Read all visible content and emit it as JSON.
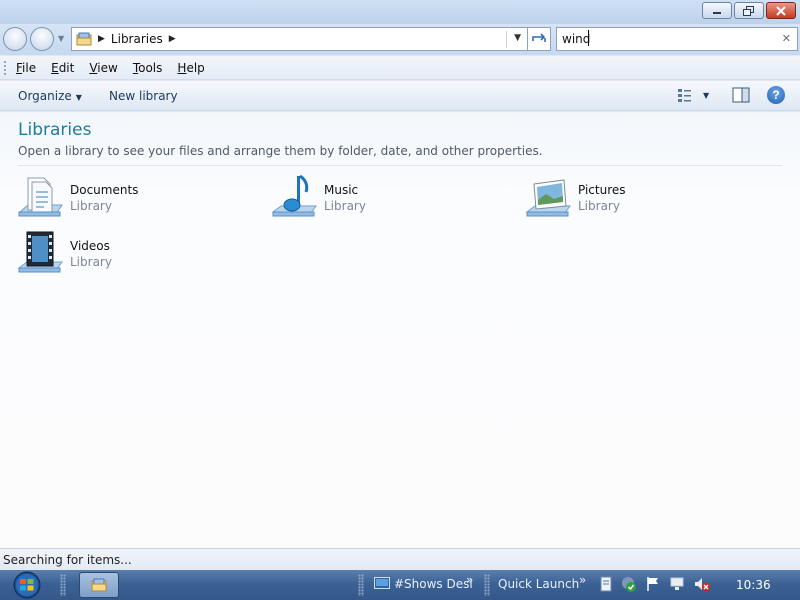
{
  "window": {
    "controls": [
      "minimize-icon",
      "restore-icon",
      "close-icon"
    ]
  },
  "address_bar": {
    "crumbs": [
      "Libraries"
    ],
    "search_value": "wind"
  },
  "menu": {
    "items": [
      {
        "label": "File",
        "accel": "F",
        "rest": "ile"
      },
      {
        "label": "Edit",
        "accel": "E",
        "rest": "dit"
      },
      {
        "label": "View",
        "accel": "V",
        "rest": "iew"
      },
      {
        "label": "Tools",
        "accel": "T",
        "rest": "ools"
      },
      {
        "label": "Help",
        "accel": "H",
        "rest": "elp"
      }
    ]
  },
  "toolbar": {
    "organize_label": "Organize",
    "new_library_label": "New library"
  },
  "content": {
    "title": "Libraries",
    "description": "Open a library to see your files and arrange them by folder, date, and other properties.",
    "libraries": [
      {
        "name": "Documents",
        "type": "Library",
        "icon": "documents-library-icon"
      },
      {
        "name": "Music",
        "type": "Library",
        "icon": "music-library-icon"
      },
      {
        "name": "Pictures",
        "type": "Library",
        "icon": "pictures-library-icon"
      },
      {
        "name": "Videos",
        "type": "Library",
        "icon": "videos-library-icon"
      }
    ]
  },
  "status_bar": {
    "text": "Searching for items..."
  },
  "taskbar": {
    "toolbar1_label": "#Shows Desl",
    "toolbar2_label": "Quick Launch",
    "clock": "10:36"
  },
  "colors": {
    "title_accent": "#1e7b9c",
    "taskbar": "#3c6194"
  }
}
